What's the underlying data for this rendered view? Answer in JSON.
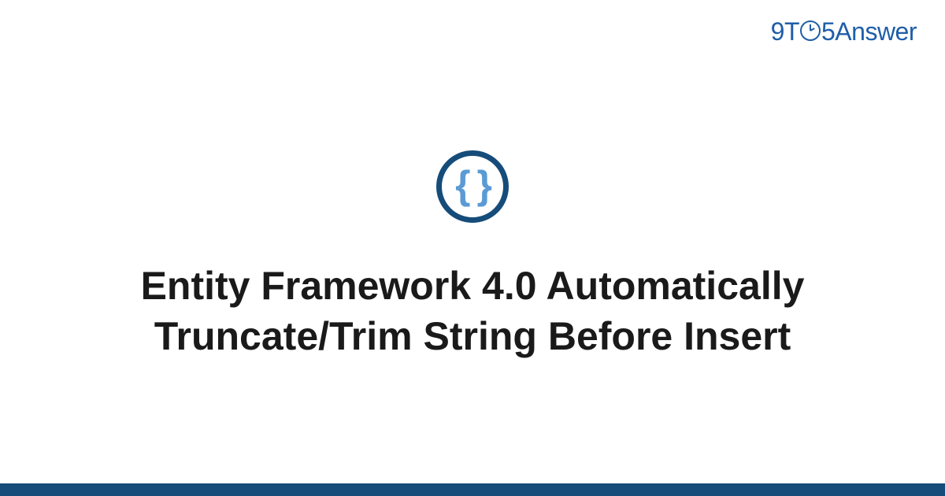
{
  "logo": {
    "part1": "9",
    "part2": "T",
    "part3": "5",
    "part4": "Answer"
  },
  "icon": {
    "semantic": "code-braces-icon",
    "glyph": "{ }"
  },
  "title": "Entity Framework 4.0 Automatically Truncate/Trim String Before Insert",
  "colors": {
    "brand_dark": "#154c79",
    "brand_light": "#5b9bd5",
    "logo_blue": "#1f5ea8"
  }
}
